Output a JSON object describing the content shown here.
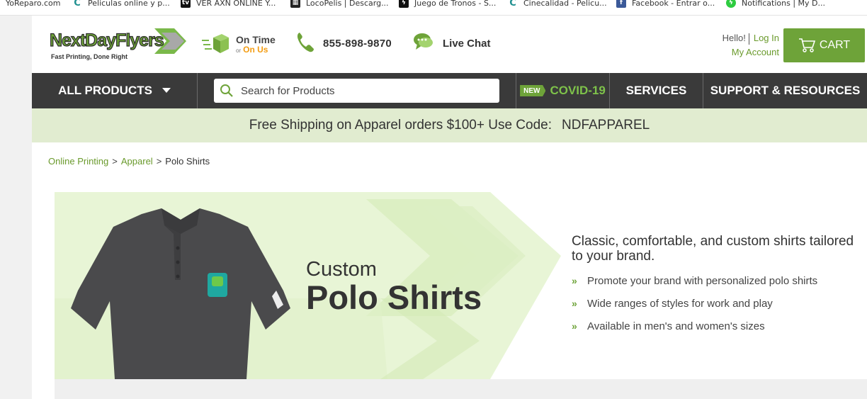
{
  "bookmarks": [
    {
      "label": "YoReparo.com",
      "icon": "globe-icon"
    },
    {
      "label": "Peliculas online y p...",
      "icon": "c-icon"
    },
    {
      "label": "VER AXN ONLINE Y...",
      "icon": "tv-icon"
    },
    {
      "label": "LocoPelis | Descarg...",
      "icon": "film-icon"
    },
    {
      "label": "Juego de Tronos - S...",
      "icon": "bolt-icon"
    },
    {
      "label": "Cinecalidad - Pelicu...",
      "icon": "c-icon"
    },
    {
      "label": "Facebook - Entrar o...",
      "icon": "facebook-icon"
    },
    {
      "label": "Notifications | My D...",
      "icon": "bolt-green-icon"
    }
  ],
  "header": {
    "logo_text": "NextDayFlyers",
    "logo_tagline": "Fast Printing, Done Right",
    "ontime_line1": "On Time",
    "ontime_or": "or",
    "ontime_line2": "On Us",
    "phone": "855-898-9870",
    "chat": "Live Chat",
    "hello": "Hello!",
    "login": "Log In",
    "my_account": "My Account",
    "cart": "CART"
  },
  "nav": {
    "all_products": "ALL PRODUCTS",
    "search_placeholder": "Search for Products",
    "new_badge": "NEW",
    "covid": "COVID-19",
    "services": "SERVICES",
    "support": "SUPPORT & RESOURCES"
  },
  "promo": {
    "text": "Free Shipping on Apparel orders $100+ Use Code:",
    "code": "NDFAPPAREL"
  },
  "breadcrumb": {
    "items": [
      "Online Printing",
      "Apparel"
    ],
    "current": "Polo Shirts",
    "separator": ">"
  },
  "hero": {
    "title_small": "Custom",
    "title_big": "Polo Shirts"
  },
  "features": {
    "lead": "Classic, comfortable, and custom shirts tailored to your brand.",
    "items": [
      "Promote your brand with personalized polo shirts",
      "Wide ranges of styles for work and play",
      "Available in men's and women's sizes"
    ]
  },
  "colors": {
    "brand_green": "#6ea339",
    "nav_dark": "#3a3a3a",
    "promo_bg": "#e1ecd0",
    "accent_orange": "#f39c12"
  }
}
